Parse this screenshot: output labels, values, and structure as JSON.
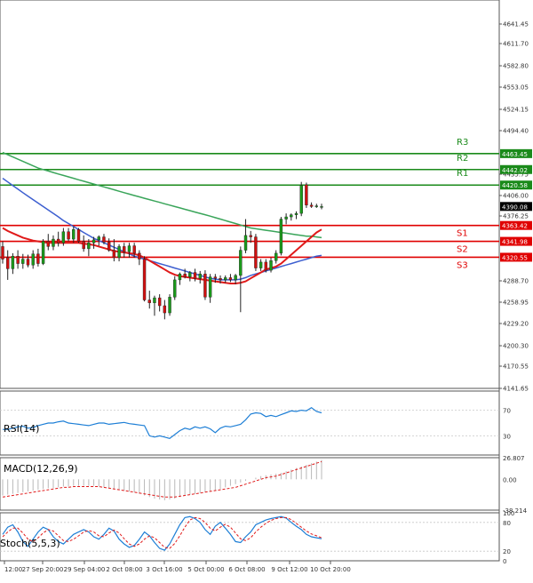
{
  "chart_data": [
    {
      "type": "candlestick",
      "panel": "price",
      "ylim": [
        4141.65,
        4641.45
      ],
      "price_ticks": [
        "4641.45",
        "4611.70",
        "4582.80",
        "4553.05",
        "4524.15",
        "4494.40",
        "4435.75",
        "4406.00",
        "4376.25",
        "4288.70",
        "4258.95",
        "4229.20",
        "4200.30",
        "4170.55",
        "4141.65"
      ],
      "price_tick_values": [
        4641.45,
        4611.7,
        4582.8,
        4553.05,
        4524.15,
        4494.4,
        4435.75,
        4406.0,
        4376.25,
        4288.7,
        4258.95,
        4229.2,
        4200.3,
        4170.55,
        4141.65
      ],
      "current_price": {
        "label": "4390.08",
        "value": 4390.08
      },
      "levels": [
        {
          "name": "R3",
          "label": "4463.45",
          "value": 4463.45,
          "color": "#1a8a1a"
        },
        {
          "name": "R2",
          "label": "4442.02",
          "value": 4442.02,
          "color": "#1a8a1a"
        },
        {
          "name": "R1",
          "label": "4420.58",
          "value": 4420.58,
          "color": "#1a8a1a"
        },
        {
          "name": "S1",
          "label": "4363.42",
          "value": 4363.42,
          "color": "#e00000"
        },
        {
          "name": "S2",
          "label": "4341.98",
          "value": 4341.98,
          "color": "#e00000"
        },
        {
          "name": "S3",
          "label": "4320.55",
          "value": 4320.55,
          "color": "#e00000"
        }
      ],
      "x_labels": [
        "12:00",
        "27 Sep 20:00",
        "29 Sep 04:00",
        "2 Oct 08:00",
        "3 Oct 16:00",
        "5 Oct 00:00",
        "6 Oct 08:00",
        "9 Oct 12:00",
        "10 Oct 20:00"
      ],
      "candles": [
        {
          "o": 4335,
          "h": 4342,
          "l": 4312,
          "c": 4318
        },
        {
          "o": 4320,
          "h": 4330,
          "l": 4290,
          "c": 4305
        },
        {
          "o": 4305,
          "h": 4326,
          "l": 4298,
          "c": 4322
        },
        {
          "o": 4322,
          "h": 4330,
          "l": 4305,
          "c": 4312
        },
        {
          "o": 4312,
          "h": 4325,
          "l": 4305,
          "c": 4318
        },
        {
          "o": 4318,
          "h": 4324,
          "l": 4307,
          "c": 4310
        },
        {
          "o": 4310,
          "h": 4330,
          "l": 4305,
          "c": 4325
        },
        {
          "o": 4325,
          "h": 4332,
          "l": 4308,
          "c": 4312
        },
        {
          "o": 4312,
          "h": 4345,
          "l": 4310,
          "c": 4342
        },
        {
          "o": 4342,
          "h": 4352,
          "l": 4330,
          "c": 4335
        },
        {
          "o": 4335,
          "h": 4350,
          "l": 4330,
          "c": 4345
        },
        {
          "o": 4345,
          "h": 4355,
          "l": 4335,
          "c": 4340
        },
        {
          "o": 4340,
          "h": 4360,
          "l": 4336,
          "c": 4355
        },
        {
          "o": 4355,
          "h": 4360,
          "l": 4342,
          "c": 4345
        },
        {
          "o": 4345,
          "h": 4362,
          "l": 4340,
          "c": 4358
        },
        {
          "o": 4358,
          "h": 4360,
          "l": 4340,
          "c": 4342
        },
        {
          "o": 4342,
          "h": 4350,
          "l": 4328,
          "c": 4332
        },
        {
          "o": 4332,
          "h": 4345,
          "l": 4322,
          "c": 4340
        },
        {
          "o": 4340,
          "h": 4348,
          "l": 4332,
          "c": 4344
        },
        {
          "o": 4344,
          "h": 4350,
          "l": 4336,
          "c": 4348
        },
        {
          "o": 4348,
          "h": 4352,
          "l": 4338,
          "c": 4341
        },
        {
          "o": 4341,
          "h": 4346,
          "l": 4328,
          "c": 4330
        },
        {
          "o": 4330,
          "h": 4345,
          "l": 4315,
          "c": 4320
        },
        {
          "o": 4320,
          "h": 4338,
          "l": 4315,
          "c": 4335
        },
        {
          "o": 4335,
          "h": 4340,
          "l": 4320,
          "c": 4328
        },
        {
          "o": 4328,
          "h": 4340,
          "l": 4320,
          "c": 4336
        },
        {
          "o": 4336,
          "h": 4340,
          "l": 4320,
          "c": 4326
        },
        {
          "o": 4326,
          "h": 4330,
          "l": 4310,
          "c": 4318
        },
        {
          "o": 4318,
          "h": 4322,
          "l": 4260,
          "c": 4262
        },
        {
          "o": 4262,
          "h": 4275,
          "l": 4250,
          "c": 4258
        },
        {
          "o": 4258,
          "h": 4268,
          "l": 4240,
          "c": 4265
        },
        {
          "o": 4265,
          "h": 4270,
          "l": 4246,
          "c": 4254
        },
        {
          "o": 4254,
          "h": 4262,
          "l": 4235,
          "c": 4244
        },
        {
          "o": 4244,
          "h": 4270,
          "l": 4240,
          "c": 4266
        },
        {
          "o": 4266,
          "h": 4295,
          "l": 4262,
          "c": 4290
        },
        {
          "o": 4290,
          "h": 4300,
          "l": 4283,
          "c": 4298
        },
        {
          "o": 4298,
          "h": 4305,
          "l": 4292,
          "c": 4294
        },
        {
          "o": 4294,
          "h": 4302,
          "l": 4288,
          "c": 4300
        },
        {
          "o": 4300,
          "h": 4305,
          "l": 4288,
          "c": 4292
        },
        {
          "o": 4292,
          "h": 4302,
          "l": 4285,
          "c": 4298
        },
        {
          "o": 4298,
          "h": 4303,
          "l": 4262,
          "c": 4266
        },
        {
          "o": 4266,
          "h": 4298,
          "l": 4258,
          "c": 4294
        },
        {
          "o": 4294,
          "h": 4298,
          "l": 4286,
          "c": 4292
        },
        {
          "o": 4292,
          "h": 4296,
          "l": 4285,
          "c": 4290
        },
        {
          "o": 4290,
          "h": 4296,
          "l": 4286,
          "c": 4293
        },
        {
          "o": 4293,
          "h": 4298,
          "l": 4287,
          "c": 4290
        },
        {
          "o": 4290,
          "h": 4298,
          "l": 4284,
          "c": 4296
        },
        {
          "o": 4296,
          "h": 4335,
          "l": 4245,
          "c": 4330
        },
        {
          "o": 4330,
          "h": 4372,
          "l": 4326,
          "c": 4350
        },
        {
          "o": 4350,
          "h": 4356,
          "l": 4340,
          "c": 4348
        },
        {
          "o": 4348,
          "h": 4352,
          "l": 4302,
          "c": 4306
        },
        {
          "o": 4306,
          "h": 4318,
          "l": 4302,
          "c": 4314
        },
        {
          "o": 4314,
          "h": 4318,
          "l": 4300,
          "c": 4303
        },
        {
          "o": 4303,
          "h": 4320,
          "l": 4300,
          "c": 4316
        },
        {
          "o": 4316,
          "h": 4330,
          "l": 4312,
          "c": 4326
        },
        {
          "o": 4326,
          "h": 4375,
          "l": 4323,
          "c": 4372
        },
        {
          "o": 4372,
          "h": 4380,
          "l": 4365,
          "c": 4375
        },
        {
          "o": 4375,
          "h": 4380,
          "l": 4370,
          "c": 4378
        },
        {
          "o": 4378,
          "h": 4383,
          "l": 4372,
          "c": 4380
        },
        {
          "o": 4380,
          "h": 4425,
          "l": 4376,
          "c": 4420
        },
        {
          "o": 4421,
          "h": 4424,
          "l": 4388,
          "c": 4392
        },
        {
          "o": 4392,
          "h": 4396,
          "l": 4388,
          "c": 4390
        },
        {
          "o": 4390,
          "h": 4394,
          "l": 4388,
          "c": 4391
        },
        {
          "o": 4390,
          "h": 4394,
          "l": 4386,
          "c": 4390
        }
      ],
      "ma_green": [
        4465,
        4462,
        4459,
        4456,
        4453,
        4450,
        4447,
        4444,
        4442,
        4440,
        4438,
        4436,
        4434,
        4432,
        4430,
        4428,
        4426,
        4424,
        4422,
        4420,
        4418,
        4416,
        4414,
        4412,
        4410,
        4408,
        4406,
        4404,
        4402,
        4400,
        4398,
        4396,
        4394,
        4392,
        4390,
        4388,
        4386,
        4384,
        4382,
        4380,
        4378,
        4376,
        4374,
        4372,
        4370,
        4368,
        4366,
        4364,
        4362,
        4360,
        4359,
        4358,
        4357,
        4356,
        4355,
        4354,
        4353,
        4352,
        4351,
        4350,
        4349,
        4349,
        4348,
        4347
      ],
      "ma_blue": [
        4430,
        4425,
        4420,
        4415,
        4410,
        4405,
        4400,
        4395,
        4390,
        4385,
        4380,
        4375,
        4370,
        4366,
        4362,
        4358,
        4354,
        4350,
        4346,
        4343,
        4340,
        4337,
        4334,
        4331,
        4328,
        4325,
        4322,
        4320,
        4318,
        4316,
        4314,
        4312,
        4310,
        4308,
        4306,
        4304,
        4302,
        4300,
        4298,
        4296,
        4294,
        4292,
        4291,
        4290,
        4290,
        4290,
        4290,
        4291,
        4293,
        4296,
        4298,
        4300,
        4302,
        4304,
        4306,
        4308,
        4310,
        4312,
        4314,
        4316,
        4318,
        4320,
        4322,
        4323
      ],
      "ma_red": [
        4360,
        4356,
        4353,
        4350,
        4347,
        4345,
        4343,
        4342,
        4341,
        4340,
        4340,
        4340,
        4340,
        4340,
        4340,
        4340,
        4339,
        4338,
        4337,
        4335,
        4333,
        4331,
        4329,
        4328,
        4327,
        4326,
        4325,
        4323,
        4320,
        4316,
        4312,
        4308,
        4304,
        4300,
        4297,
        4295,
        4294,
        4293,
        4292,
        4291,
        4290,
        4289,
        4288,
        4287,
        4286,
        4285,
        4285,
        4286,
        4288,
        4292,
        4296,
        4300,
        4304,
        4306,
        4308,
        4312,
        4318,
        4324,
        4330,
        4336,
        4342,
        4348,
        4354,
        4358
      ]
    },
    {
      "type": "line",
      "panel": "rsi",
      "title": "RSI(14)",
      "ylim": [
        0,
        100
      ],
      "ticks": [
        "70",
        "30"
      ],
      "tick_values": [
        70,
        30
      ],
      "values": [
        40,
        40,
        42,
        44,
        45,
        42,
        43,
        46,
        48,
        50,
        50,
        52,
        53,
        50,
        49,
        48,
        47,
        46,
        48,
        50,
        50,
        48,
        49,
        50,
        51,
        49,
        48,
        47,
        46,
        30,
        28,
        30,
        28,
        26,
        32,
        38,
        42,
        40,
        44,
        42,
        44,
        41,
        35,
        42,
        45,
        44,
        46,
        48,
        55,
        64,
        66,
        65,
        60,
        62,
        60,
        63,
        66,
        69,
        68,
        70,
        69,
        74,
        68,
        66
      ]
    },
    {
      "type": "bar",
      "panel": "macd",
      "title": "MACD(12,26,9)",
      "ylim": [
        -38.214,
        26.807
      ],
      "ticks": [
        "26.807",
        "0.00",
        "-38.214"
      ],
      "tick_values": [
        26.807,
        0,
        -38.214
      ],
      "histogram": [
        -20,
        -19,
        -18,
        -17,
        -16,
        -15,
        -14,
        -13,
        -12,
        -11,
        -11,
        -10,
        -9,
        -9,
        -8,
        -8,
        -8,
        -8,
        -8,
        -9,
        -10,
        -11,
        -12,
        -13,
        -14,
        -15,
        -16,
        -18,
        -20,
        -22,
        -24,
        -25,
        -26,
        -25,
        -24,
        -22,
        -20,
        -19,
        -18,
        -17,
        -16,
        -15,
        -14,
        -12,
        -10,
        -8,
        -6,
        -4,
        -2,
        0,
        2,
        4,
        5,
        6,
        7,
        8,
        10,
        12,
        14,
        16,
        18,
        20,
        22,
        24
      ],
      "signal": [
        -22,
        -21,
        -20,
        -19,
        -18,
        -17,
        -16,
        -15,
        -14,
        -13,
        -12,
        -11,
        -10,
        -10,
        -9,
        -9,
        -9,
        -9,
        -9,
        -9,
        -10,
        -11,
        -12,
        -13,
        -14,
        -15,
        -16,
        -17,
        -18,
        -19,
        -20,
        -21,
        -22,
        -22,
        -22,
        -21,
        -20,
        -19,
        -18,
        -17,
        -16,
        -15,
        -14,
        -13,
        -12,
        -11,
        -10,
        -8,
        -6,
        -4,
        -2,
        0,
        2,
        3,
        4,
        6,
        8,
        10,
        12,
        14,
        16,
        18,
        20,
        22
      ]
    },
    {
      "type": "line",
      "panel": "stochastic",
      "title": "Stoch(5,5,3)",
      "ylim": [
        0,
        100
      ],
      "ticks": [
        "100",
        "80",
        "20",
        "0"
      ],
      "tick_values": [
        100,
        80,
        20,
        0
      ],
      "k_line": [
        55,
        70,
        75,
        60,
        40,
        30,
        45,
        60,
        70,
        65,
        50,
        40,
        35,
        45,
        55,
        60,
        65,
        60,
        50,
        45,
        55,
        68,
        62,
        45,
        35,
        28,
        32,
        45,
        60,
        52,
        38,
        26,
        22,
        35,
        55,
        75,
        90,
        92,
        88,
        80,
        65,
        55,
        72,
        80,
        68,
        55,
        40,
        38,
        50,
        60,
        75,
        80,
        85,
        88,
        90,
        92,
        89,
        80,
        72,
        65,
        55,
        50,
        48,
        46
      ],
      "d_line": [
        50,
        60,
        68,
        68,
        58,
        45,
        40,
        48,
        58,
        65,
        62,
        52,
        42,
        40,
        45,
        52,
        60,
        63,
        60,
        52,
        50,
        58,
        64,
        58,
        46,
        35,
        30,
        35,
        45,
        52,
        48,
        38,
        28,
        26,
        36,
        52,
        70,
        85,
        90,
        88,
        80,
        68,
        62,
        70,
        76,
        70,
        58,
        46,
        42,
        48,
        60,
        70,
        78,
        84,
        88,
        90,
        90,
        86,
        78,
        70,
        62,
        56,
        52,
        48
      ]
    }
  ]
}
